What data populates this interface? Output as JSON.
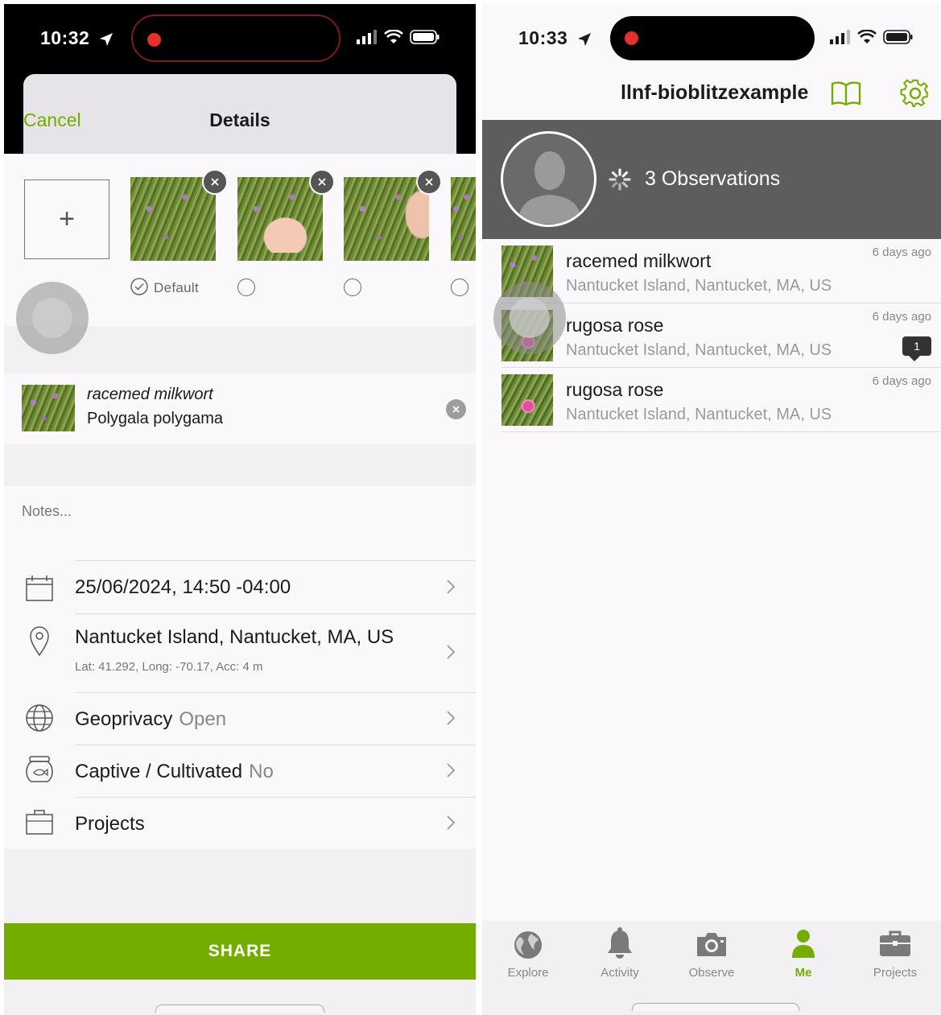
{
  "left_screen": {
    "status": {
      "time": "10:32"
    },
    "header": {
      "cancel_label": "Cancel",
      "title": "Details"
    },
    "photos": {
      "add_label": "+",
      "default_label": "Default"
    },
    "taxon": {
      "common_name": "racemed milkwort",
      "scientific_name": "Polygala polygama"
    },
    "notes_placeholder": "Notes...",
    "rows": {
      "date": {
        "label": "25/06/2024, 14:50 -04:00"
      },
      "location": {
        "label": "Nantucket Island, Nantucket, MA, US",
        "sub": "Lat: 41.292, Long: -70.17, Acc: 4 m"
      },
      "geoprivacy": {
        "label": "Geoprivacy",
        "value": "Open"
      },
      "captive": {
        "label": "Captive / Cultivated",
        "value": "No"
      },
      "projects": {
        "label": "Projects"
      }
    },
    "share_label": "SHARE"
  },
  "right_screen": {
    "status": {
      "time": "10:33"
    },
    "header": {
      "username": "llnf-bioblitzexample"
    },
    "profile": {
      "observation_count": "3 Observations"
    },
    "observations": [
      {
        "name": "racemed milkwort",
        "place": "Nantucket Island, Nantucket, MA, US",
        "time": "6 days ago"
      },
      {
        "name": "rugosa rose",
        "place": "Nantucket Island, Nantucket, MA, US",
        "time": "6 days ago",
        "comments": "1"
      },
      {
        "name": "rugosa rose",
        "place": "Nantucket Island, Nantucket, MA, US",
        "time": "6 days ago"
      }
    ],
    "tabs": [
      {
        "label": "Explore",
        "icon": "globe-icon"
      },
      {
        "label": "Activity",
        "icon": "bell-icon"
      },
      {
        "label": "Observe",
        "icon": "camera-icon"
      },
      {
        "label": "Me",
        "icon": "person-icon",
        "active": true
      },
      {
        "label": "Projects",
        "icon": "briefcase-icon"
      }
    ]
  },
  "colors": {
    "accent": "#74ac00",
    "band": "#5d5d5d",
    "record": "#e5312c"
  }
}
